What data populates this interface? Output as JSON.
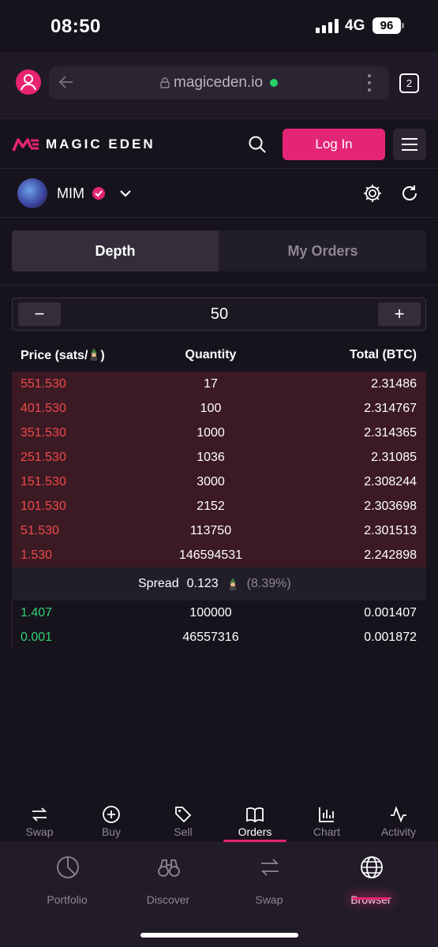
{
  "status_bar": {
    "time": "08:50",
    "network": "4G",
    "battery": "96"
  },
  "browser": {
    "url": "magiceden.io",
    "tab_count": "2"
  },
  "header": {
    "logo_text": "MAGIC EDEN",
    "login_label": "Log In"
  },
  "collection": {
    "name": "MIM"
  },
  "tabs": [
    {
      "label": "Depth",
      "active": true
    },
    {
      "label": "My Orders",
      "active": false
    }
  ],
  "stepper": {
    "minus": "−",
    "value": "50",
    "plus": "+"
  },
  "orderbook": {
    "columns": {
      "price": "Price (sats/",
      "price_suffix": ")",
      "quantity": "Quantity",
      "total": "Total (BTC)"
    },
    "asks": [
      {
        "price": "551.530",
        "quantity": "17",
        "total": "2.31486"
      },
      {
        "price": "401.530",
        "quantity": "100",
        "total": "2.314767"
      },
      {
        "price": "351.530",
        "quantity": "1000",
        "total": "2.314365"
      },
      {
        "price": "251.530",
        "quantity": "1036",
        "total": "2.31085"
      },
      {
        "price": "151.530",
        "quantity": "3000",
        "total": "2.308244"
      },
      {
        "price": "101.530",
        "quantity": "2152",
        "total": "2.303698"
      },
      {
        "price": "51.530",
        "quantity": "113750",
        "total": "2.301513"
      },
      {
        "price": "1.530",
        "quantity": "146594531",
        "total": "2.242898"
      }
    ],
    "spread": {
      "label": "Spread",
      "value": "0.123",
      "percent": "(8.39%)"
    },
    "bids": [
      {
        "price": "1.407",
        "quantity": "100000",
        "total": "0.001407"
      },
      {
        "price": "0.001",
        "quantity": "46557316",
        "total": "0.001872"
      }
    ]
  },
  "subnav": [
    {
      "label": "Swap",
      "icon": "swap-icon"
    },
    {
      "label": "Buy",
      "icon": "plus-circle-icon"
    },
    {
      "label": "Sell",
      "icon": "tag-icon"
    },
    {
      "label": "Orders",
      "icon": "book-icon",
      "active": true
    },
    {
      "label": "Chart",
      "icon": "bar-chart-icon"
    },
    {
      "label": "Activity",
      "icon": "activity-icon"
    }
  ],
  "mainnav": [
    {
      "label": "Portfolio",
      "icon": "pie-chart-icon"
    },
    {
      "label": "Discover",
      "icon": "binoculars-icon"
    },
    {
      "label": "Swap",
      "icon": "swap-icon"
    },
    {
      "label": "Browser",
      "icon": "globe-icon",
      "active": true
    }
  ],
  "colors": {
    "accent": "#e42575",
    "ask": "#ef4a4a",
    "bid": "#32d174",
    "ask_bg": "#3b1a24"
  }
}
